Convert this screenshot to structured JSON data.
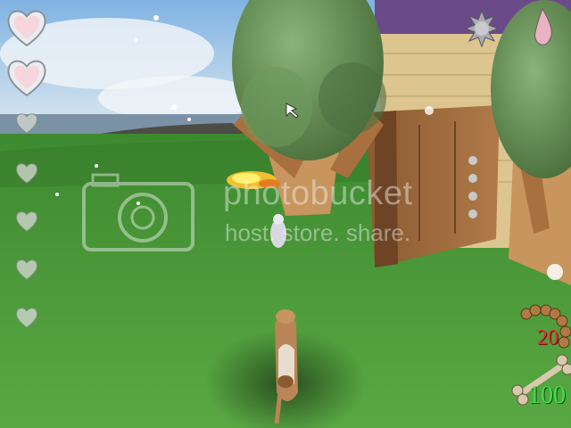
{
  "hud": {
    "health_icon": "heart-icon",
    "hearts_total": 7,
    "hearts_full": 2,
    "sausage_icon": "sausage-icon",
    "sausage_count": "20",
    "bone_icon": "bone-icon",
    "bone_count": "100",
    "compass_icon": "spiky-ball-icon",
    "status_icon": "droplet-icon"
  },
  "watermark": {
    "line1": "photobucket",
    "line2": "host. store. share."
  },
  "colors": {
    "sky": "#9cc8ec",
    "grass": "#4a9a3a",
    "foliage": "#5e8a4a",
    "wood": "#b8865a",
    "sausage_count": "#e0302a",
    "bone_count": "#3de04a"
  }
}
